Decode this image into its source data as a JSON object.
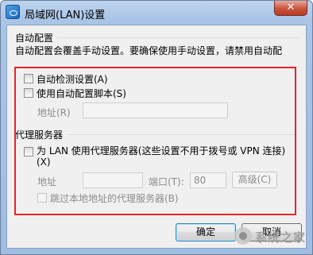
{
  "window": {
    "title": "局域网(LAN)设置",
    "close_glyph": "✕"
  },
  "auto_config": {
    "group_label": "自动配置",
    "description": "自动配置会覆盖手动设置。要确保使用手动设置，请禁用自动配",
    "auto_detect_label": "自动检测设置(A)",
    "auto_detect_checked": false,
    "use_script_label": "使用自动配置脚本(S)",
    "use_script_checked": false,
    "address_label": "地址(R)",
    "address_value": ""
  },
  "proxy": {
    "group_label": "代理服务器",
    "use_proxy_label_line1": "为 LAN 使用代理服务器(这些设置不用于拨号或 VPN 连接)",
    "use_proxy_label_line2": "(X)",
    "use_proxy_checked": false,
    "address_label": "地址",
    "address_value": "",
    "port_label": "端口(T):",
    "port_value": "80",
    "advanced_label": "高级(C)",
    "bypass_label": "跳过本地地址的代理服务器(B)",
    "bypass_checked": false
  },
  "buttons": {
    "ok_label": "确定",
    "cancel_label": "取消"
  },
  "annotation": {
    "highlight_color": "#e8222a"
  },
  "watermark": {
    "text": "系统之家"
  }
}
